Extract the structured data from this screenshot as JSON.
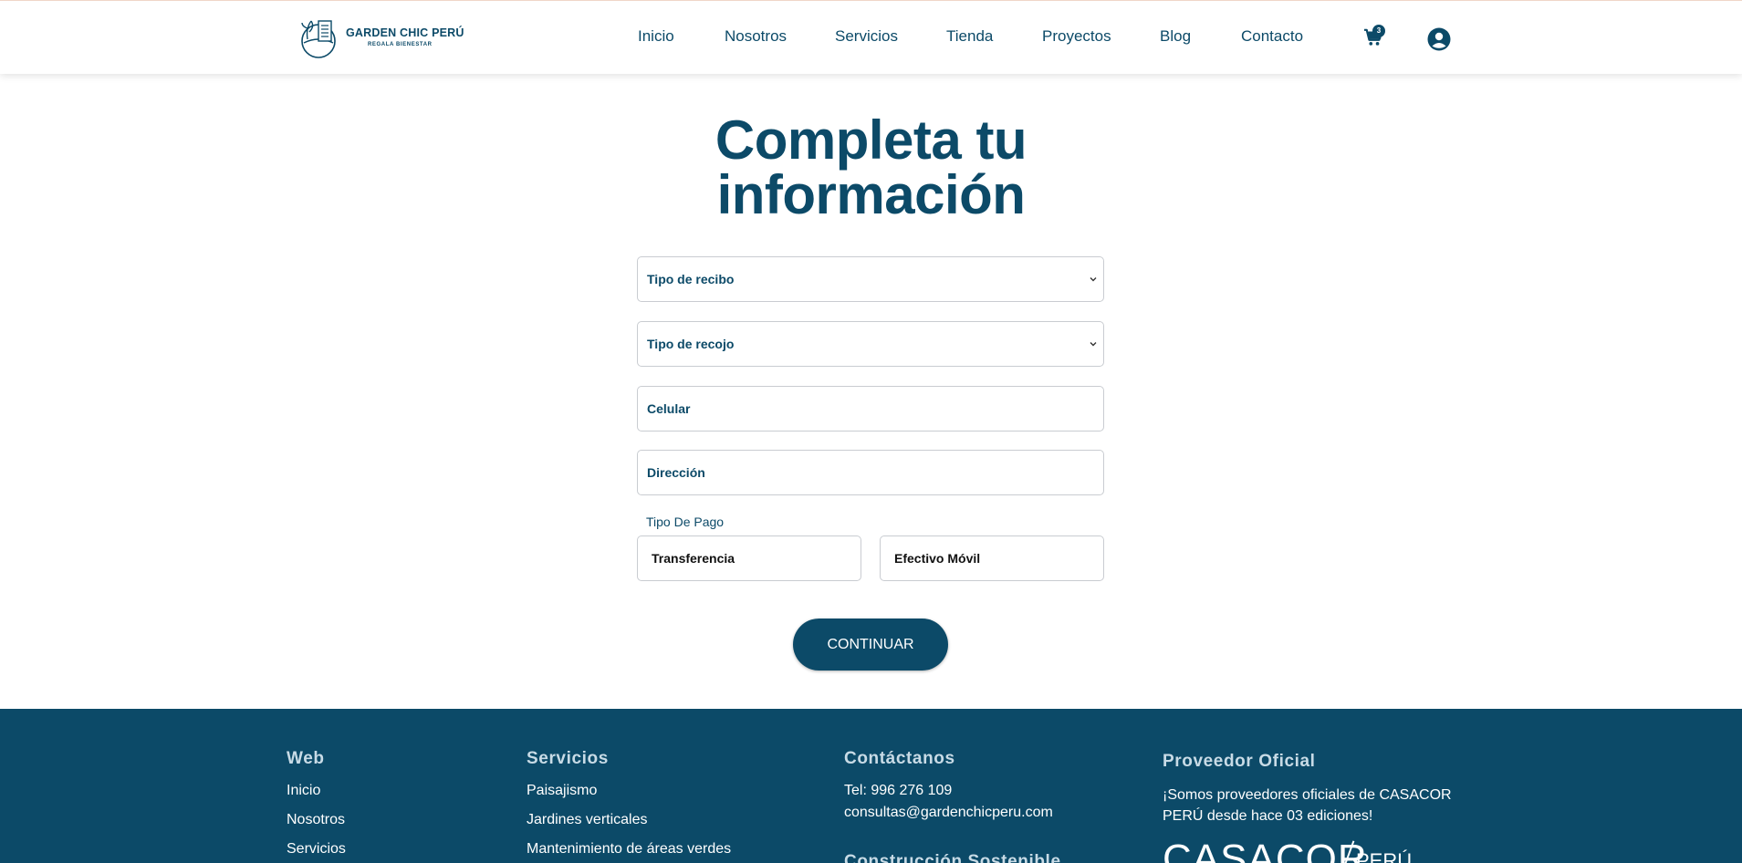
{
  "header": {
    "logo": {
      "name": "GARDEN CHIC PERÚ",
      "tagline": "REGALA BIENESTAR"
    },
    "nav": [
      {
        "label": "Inicio"
      },
      {
        "label": "Nosotros"
      },
      {
        "label": "Servicios"
      },
      {
        "label": "Tienda"
      },
      {
        "label": "Proyectos"
      },
      {
        "label": "Blog"
      },
      {
        "label": "Contacto"
      }
    ],
    "cart": {
      "icon": "cart-icon",
      "count": "3"
    },
    "user": {
      "icon": "user-account-icon"
    }
  },
  "form": {
    "title_line1": "Completa tu",
    "title_line2": "información",
    "receipt_type": "Tipo de recibo",
    "pickup_type": "Tipo de recojo",
    "phone": "Celular",
    "address": "Dirección",
    "payment_label": "Tipo De Pago",
    "payment_options": [
      "Transferencia",
      "Efectivo Móvil"
    ],
    "continue_label": "CONTINUAR"
  },
  "footer": {
    "web": {
      "heading": "Web",
      "links": [
        "Inicio",
        "Nosotros",
        "Servicios"
      ]
    },
    "services": {
      "heading": "Servicios",
      "links": [
        "Paisajismo",
        "Jardines verticales",
        "Mantenimiento de áreas verdes"
      ]
    },
    "contact": {
      "heading": "Contáctanos",
      "phone": "Tel: 996 276 109",
      "email": "consultas@gardenchicperu.com",
      "subheading": "Construcción Sostenible"
    },
    "provider": {
      "heading": "Proveedor Oficial",
      "text_line1": "¡Somos proveedores oficiales de CASACOR",
      "text_line2": "PERÚ desde hace 03 ediciones!",
      "brand": "CASACOR",
      "brand_country": "PERÚ"
    }
  },
  "colors": {
    "primary": "#0c4a68",
    "footer_heading": "#c8dbe6",
    "border": "#c9ccd1"
  }
}
